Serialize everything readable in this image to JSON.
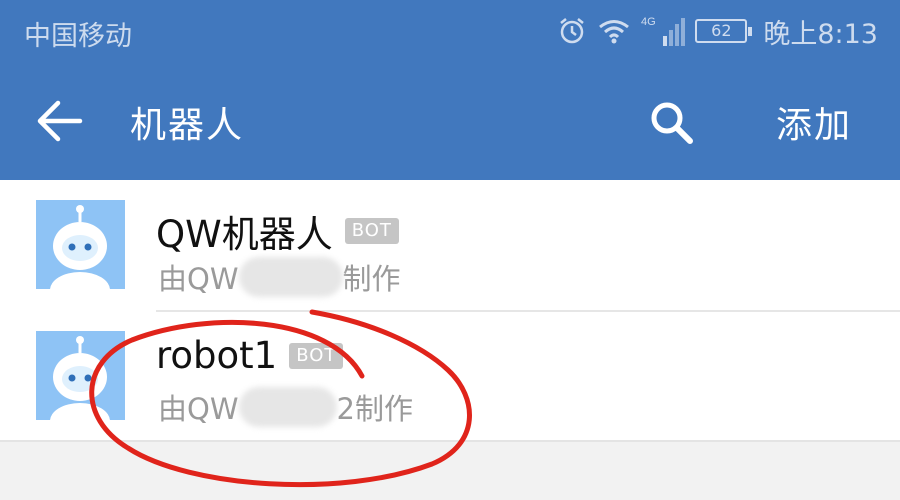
{
  "status_bar": {
    "carrier": "中国移动",
    "network": "4G",
    "battery": "62",
    "time": "晚上8:13"
  },
  "app_bar": {
    "title": "机器人",
    "add_label": "添加"
  },
  "robots": [
    {
      "name": "QW机器人",
      "badge": "BOT",
      "maker_prefix": "由QW",
      "maker_suffix": "制作"
    },
    {
      "name": "robot1",
      "badge": "BOT",
      "maker_prefix": "由QW",
      "maker_suffix": "2制作"
    }
  ],
  "colors": {
    "header": "#4178be",
    "avatar": "#8ec3f5",
    "badge": "#c5c5c5",
    "annotation": "#e0241b"
  },
  "icons": {
    "back": "arrow-left-icon",
    "search": "search-icon",
    "alarm": "alarm-icon",
    "wifi": "wifi-icon",
    "signal": "signal-icon",
    "avatar": "robot-avatar-icon"
  }
}
